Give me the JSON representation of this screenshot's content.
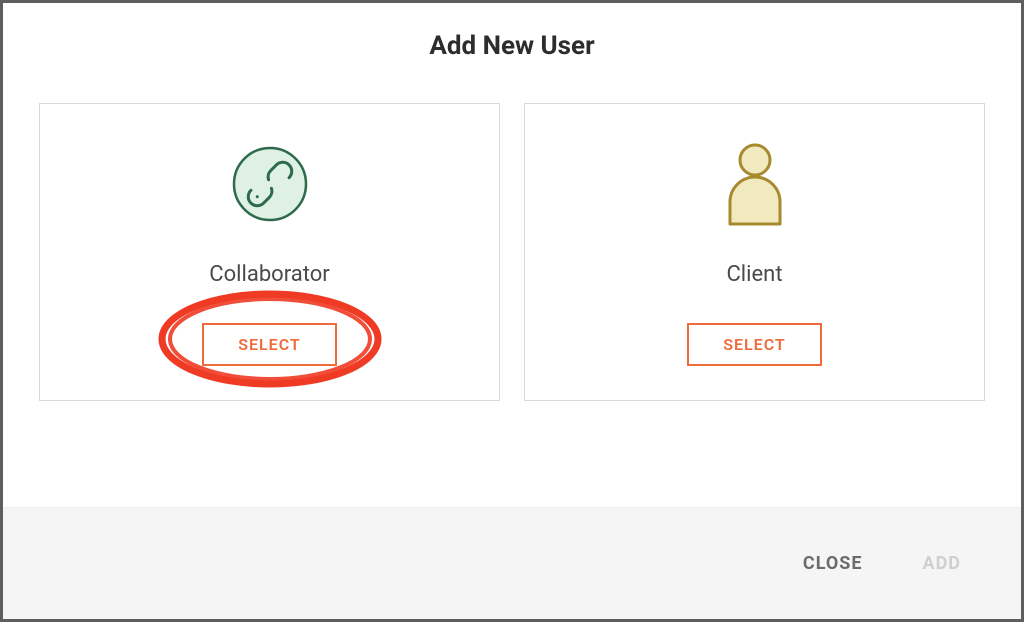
{
  "modal": {
    "title": "Add New User",
    "cards": [
      {
        "label": "Collaborator",
        "button_label": "SELECT",
        "icon": "link-icon",
        "highlighted": true
      },
      {
        "label": "Client",
        "button_label": "SELECT",
        "icon": "person-icon",
        "highlighted": false
      }
    ],
    "footer": {
      "close_label": "CLOSE",
      "add_label": "ADD"
    }
  },
  "colors": {
    "accent": "#ee6b3b",
    "link_icon_stroke": "#2d6a4a",
    "link_icon_fill": "#dff0e4",
    "person_icon_stroke": "#a78a2f",
    "person_icon_fill": "#f2eabf",
    "highlight_stroke": "#ef3a24"
  }
}
